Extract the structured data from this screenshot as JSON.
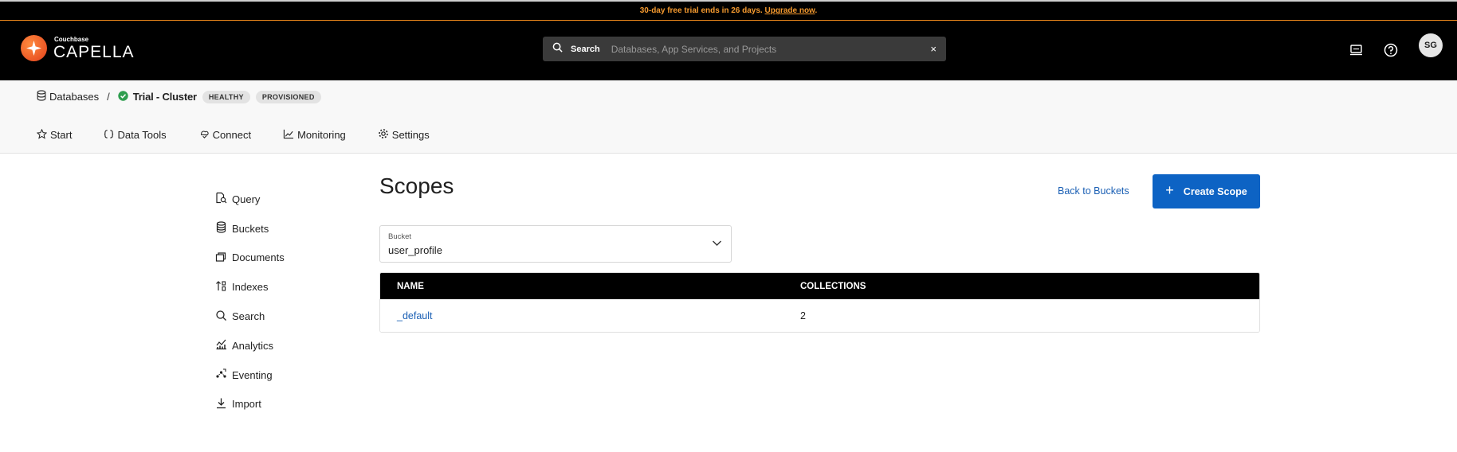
{
  "banner": {
    "text": "30-day free trial ends in 26 days. ",
    "link": "Upgrade now",
    "suffix": "."
  },
  "brand": {
    "small": "Couchbase",
    "big": "CAPELLA"
  },
  "search": {
    "label": "Search",
    "placeholder": "Databases, App Services, and Projects",
    "clear": "×"
  },
  "header_icons": [
    "kbd-icon",
    "help-icon"
  ],
  "user": {
    "initials": "SG"
  },
  "breadcrumb": {
    "root": "Databases",
    "separator": "/",
    "cluster": "Trial - Cluster",
    "badges": [
      "HEALTHY",
      "PROVISIONED"
    ]
  },
  "tabs": [
    "Start",
    "Data Tools",
    "Connect",
    "Monitoring",
    "Settings"
  ],
  "sidenav": [
    "Query",
    "Buckets",
    "Documents",
    "Indexes",
    "Search",
    "Analytics",
    "Eventing",
    "Import"
  ],
  "main": {
    "title": "Scopes",
    "back_link": "Back to Buckets",
    "create_button": "Create Scope",
    "bucket_select": {
      "label": "Bucket",
      "value": "user_profile"
    },
    "table": {
      "headers": [
        "NAME",
        "COLLECTIONS"
      ],
      "rows": [
        {
          "name": "_default",
          "collections": "2"
        }
      ]
    }
  },
  "colors": {
    "accent": "#0d63c4",
    "link": "#1a5fb4",
    "trial": "#f59a2f",
    "healthy": "#2e9e4f"
  }
}
